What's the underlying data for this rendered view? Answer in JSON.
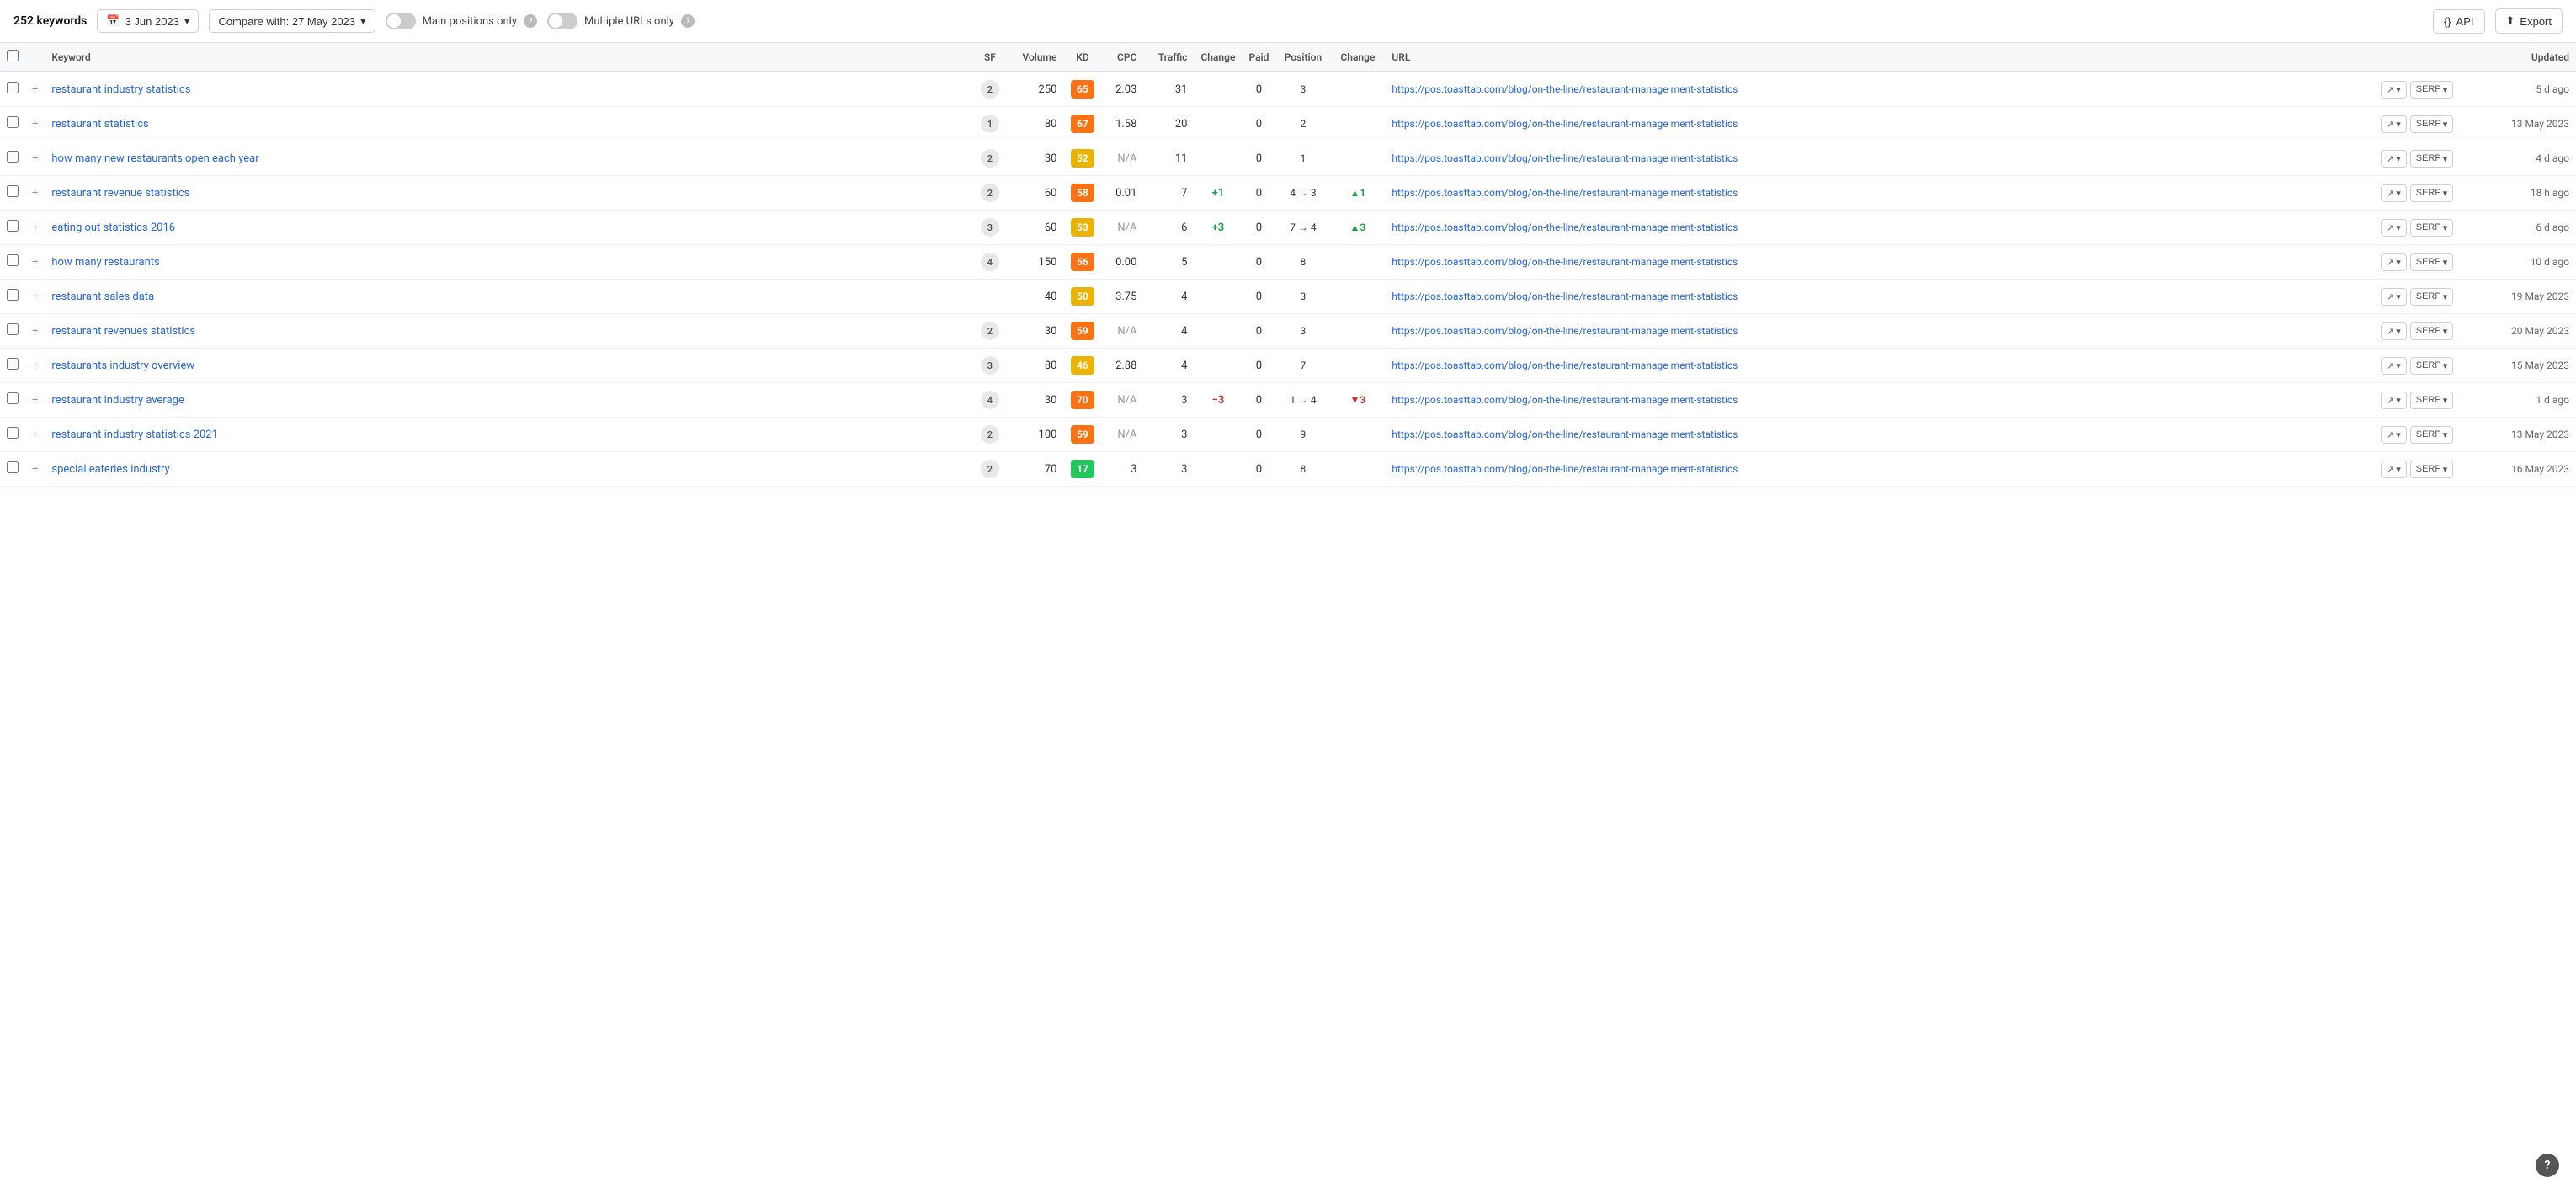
{
  "toolbar": {
    "keywords_count": "252 keywords",
    "date_label": "3 Jun 2023",
    "compare_label": "Compare with: 27 May 2023",
    "main_positions_label": "Main positions only",
    "multiple_urls_label": "Multiple URLs only",
    "api_label": "API",
    "export_label": "Export"
  },
  "table": {
    "headers": {
      "checkbox": "",
      "plus": "",
      "keyword": "Keyword",
      "sf": "SF",
      "volume": "Volume",
      "kd": "KD",
      "cpc": "CPC",
      "traffic": "Traffic",
      "change": "Change",
      "paid": "Paid",
      "position": "Position",
      "pos_change": "Change",
      "url": "URL",
      "actions": "",
      "updated": "Updated"
    },
    "rows": [
      {
        "keyword": "restaurant industry statistics",
        "sf": "2",
        "volume": "250",
        "kd": "65",
        "kd_color": "kd-orange",
        "cpc": "2.03",
        "traffic": "31",
        "change": "",
        "paid": "0",
        "position": "3",
        "pos_change": "",
        "pos_arrow": "",
        "url": "https://pos.toasttab.com/blog/on-the-line/restaurant-manage ment-statistics",
        "updated": "5 d ago"
      },
      {
        "keyword": "restaurant statistics",
        "sf": "1",
        "volume": "80",
        "kd": "67",
        "kd_color": "kd-orange",
        "cpc": "1.58",
        "traffic": "20",
        "change": "",
        "paid": "0",
        "position": "2",
        "pos_change": "",
        "pos_arrow": "",
        "url": "https://pos.toasttab.com/blog/on-the-line/restaurant-manage ment-statistics",
        "updated": "13 May 2023"
      },
      {
        "keyword": "how many new restaurants open each year",
        "sf": "2",
        "volume": "30",
        "kd": "52",
        "kd_color": "kd-yellow",
        "cpc": "N/A",
        "traffic": "11",
        "change": "",
        "paid": "0",
        "position": "1",
        "pos_change": "",
        "pos_arrow": "",
        "url": "https://pos.toasttab.com/blog/on-the-line/restaurant-manage ment-statistics",
        "updated": "4 d ago"
      },
      {
        "keyword": "restaurant revenue statistics",
        "sf": "2",
        "volume": "60",
        "kd": "58",
        "kd_color": "kd-orange",
        "cpc": "0.01",
        "traffic": "7",
        "change": "+1",
        "change_type": "pos",
        "paid": "0",
        "position": "4 → 3",
        "pos_change": "▲1",
        "pos_change_type": "up",
        "url": "https://pos.toasttab.com/blog/on-the-line/restaurant-manage ment-statistics",
        "updated": "18 h ago"
      },
      {
        "keyword": "eating out statistics 2016",
        "sf": "3",
        "volume": "60",
        "kd": "53",
        "kd_color": "kd-yellow",
        "cpc": "N/A",
        "traffic": "6",
        "change": "+3",
        "change_type": "pos",
        "paid": "0",
        "position": "7 → 4",
        "pos_change": "▲3",
        "pos_change_type": "up",
        "url": "https://pos.toasttab.com/blog/on-the-line/restaurant-manage ment-statistics",
        "updated": "6 d ago"
      },
      {
        "keyword": "how many restaurants",
        "sf": "4",
        "volume": "150",
        "kd": "56",
        "kd_color": "kd-orange",
        "cpc": "0.00",
        "traffic": "5",
        "change": "",
        "paid": "0",
        "position": "8",
        "pos_change": "",
        "pos_arrow": "",
        "url": "https://pos.toasttab.com/blog/on-the-line/restaurant-manage ment-statistics",
        "updated": "10 d ago"
      },
      {
        "keyword": "restaurant sales data",
        "sf": "",
        "volume": "40",
        "kd": "50",
        "kd_color": "kd-yellow",
        "cpc": "3.75",
        "traffic": "4",
        "change": "",
        "paid": "0",
        "position": "3",
        "pos_change": "",
        "pos_arrow": "",
        "url": "https://pos.toasttab.com/blog/on-the-line/restaurant-manage ment-statistics",
        "updated": "19 May 2023"
      },
      {
        "keyword": "restaurant revenues statistics",
        "sf": "2",
        "volume": "30",
        "kd": "59",
        "kd_color": "kd-orange",
        "cpc": "N/A",
        "traffic": "4",
        "change": "",
        "paid": "0",
        "position": "3",
        "pos_change": "",
        "pos_arrow": "",
        "url": "https://pos.toasttab.com/blog/on-the-line/restaurant-manage ment-statistics",
        "updated": "20 May 2023"
      },
      {
        "keyword": "restaurants industry overview",
        "sf": "3",
        "volume": "80",
        "kd": "46",
        "kd_color": "kd-yellow",
        "cpc": "2.88",
        "traffic": "4",
        "change": "",
        "paid": "0",
        "position": "7",
        "pos_change": "",
        "pos_arrow": "",
        "url": "https://pos.toasttab.com/blog/on-the-line/restaurant-manage ment-statistics",
        "updated": "15 May 2023"
      },
      {
        "keyword": "restaurant industry average",
        "sf": "4",
        "volume": "30",
        "kd": "70",
        "kd_color": "kd-orange",
        "cpc": "N/A",
        "traffic": "3",
        "change": "−3",
        "change_type": "neg",
        "paid": "0",
        "position": "1 → 4",
        "pos_change": "▼3",
        "pos_change_type": "down",
        "url": "https://pos.toasttab.com/blog/on-the-line/restaurant-manage ment-statistics",
        "updated": "1 d ago"
      },
      {
        "keyword": "restaurant industry statistics 2021",
        "sf": "2",
        "volume": "100",
        "kd": "59",
        "kd_color": "kd-orange",
        "cpc": "N/A",
        "traffic": "3",
        "change": "",
        "paid": "0",
        "position": "9",
        "pos_change": "",
        "pos_arrow": "",
        "url": "https://pos.toasttab.com/blog/on-the-line/restaurant-manage ment-statistics",
        "updated": "13 May 2023"
      },
      {
        "keyword": "special eateries industry",
        "sf": "2",
        "volume": "70",
        "kd": "17",
        "kd_color": "kd-green",
        "cpc": "3",
        "traffic": "3",
        "change": "",
        "paid": "0",
        "position": "8",
        "pos_change": "",
        "pos_arrow": "",
        "url": "https://pos.toasttab.com/blog/on-the-line/restaurant-manage ment-statistics",
        "updated": "16 May 2023"
      }
    ]
  },
  "help": {
    "label": "?"
  }
}
